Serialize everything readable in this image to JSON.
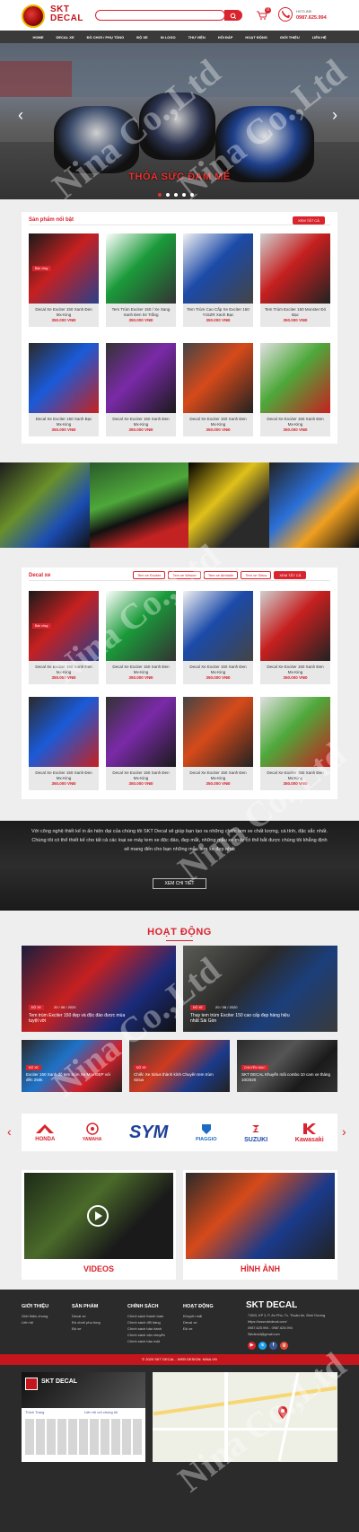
{
  "header": {
    "logo_top": "SKT",
    "logo_bottom": "DECAL",
    "cart_count": "0",
    "hotline_label": "HOTLINE",
    "hotline_number": "0987.625.994"
  },
  "nav": [
    "HOME",
    "DECAL XE",
    "ĐỒ CHƠI / PHỤ TÙNG",
    "ĐỘ XE",
    "IN LOGO",
    "THƯ VIỆN",
    "HỎI ĐÁP",
    "HOẠT ĐỘNG",
    "GIỚI THIỆU",
    "LIÊN HỆ"
  ],
  "banner": {
    "slogan": "THỎA SỨC ĐAM MÊ",
    "prev": "‹",
    "next": "›"
  },
  "featured": {
    "title": "Sản phẩm nổi bật",
    "view_all": "XEM TẤT CẢ",
    "products": [
      {
        "name": "Decal Xe Exciter 150 Xanh Đen Mx-King",
        "price": "350.000 VNĐ",
        "badge": "Bán chạy"
      },
      {
        "name": "Tem Trùm Exciter 150 / Xe Sang Xanh Đen 04 Trắng",
        "price": "350.000 VNĐ"
      },
      {
        "name": "Tem Trùm Cao Cấp Xe Exciter 150 Y15ZR Xanh Bạc",
        "price": "350.000 VNĐ"
      },
      {
        "name": "Tem Trùm Exciter 150 Monster Đỏ Bạc",
        "price": "350.000 VNĐ"
      },
      {
        "name": "Decal Xe Exciter 150 Xanh Bạc Mx-King",
        "price": "350.000 VNĐ"
      },
      {
        "name": "Decal Xe Exciter 150 Xanh Đen Mx-King",
        "price": "350.000 VNĐ"
      },
      {
        "name": "Decal Xe Exciter 150 Xanh Đen Mx-King",
        "price": "350.000 VNĐ"
      },
      {
        "name": "Decal Xe Exciter 150 Xanh Đen Mx-King",
        "price": "350.000 VNĐ"
      }
    ]
  },
  "decal": {
    "title": "Decal xe",
    "tabs": [
      "Tem xe Exciter",
      "Tem xe Winner",
      "Tem xe Airblade",
      "Tem xe Sirius"
    ],
    "view_all": "XEM TẤT CẢ",
    "products": [
      {
        "name": "Decal Xe Exciter 150 Xanh Đen Mx-King",
        "price": "350.000 VNĐ",
        "badge": "Bán chạy"
      },
      {
        "name": "Decal Xe Exciter 150 Xanh Đen Mx-King",
        "price": "350.000 VNĐ"
      },
      {
        "name": "Decal Xe Exciter 150 Xanh Đen Mx-King",
        "price": "350.000 VNĐ"
      },
      {
        "name": "Decal Xe Exciter 150 Xanh Đen Mx-King",
        "price": "350.000 VNĐ"
      },
      {
        "name": "Decal Xe Exciter 150 Xanh Đen Mx-King",
        "price": "350.000 VNĐ"
      },
      {
        "name": "Decal Xe Exciter 150 Xanh Đen Mx-King",
        "price": "350.000 VNĐ"
      },
      {
        "name": "Decal Xe Exciter 150 Xanh Đen Mx-King",
        "price": "350.000 VNĐ"
      },
      {
        "name": "Decal Xe Exciter 150 Xanh Đen Mx-King",
        "price": "350.000 VNĐ"
      }
    ]
  },
  "about": {
    "text": "Với công nghệ thiết kế in ấn hiện đại của chúng tôi SKT Decal sẽ giúp bạn tạo ra những chiếc tem xe chất lượng, cá tính, đặc sắc nhất. Chúng tôi có thể thiết kế cho tất cả các loại xe máy tem xe độc đáo, đẹp mắt, những mẫu xe máy có thể bắt được chúng tôi khẳng định sẽ mang đến cho bạn những mẫu tem xe đẹp nhất",
    "button": "XEM CHI TIẾT"
  },
  "activities": {
    "title": "HOẠT ĐỘNG",
    "items": [
      {
        "tag": "ĐỘ XE",
        "date": "20 / 08 / 2020",
        "caption": "Tem trùm Exciter 150 đẹp và độc đáo được mùa tuyệt vời"
      },
      {
        "tag": "ĐỘ XE",
        "date": "20 / 08 / 2020",
        "caption": "Thay tem trùm Exciter 150 cao cấp đẹp hàng hiệu nhất Sài Gòn"
      },
      {
        "tag": "ĐỘ XE",
        "caption": "Exciter 150 Xanh độ tem trùm Xe Max ĐẸP với đến 250k"
      },
      {
        "tag": "ĐỘ XE",
        "caption": "Chiếc Xe Sirius thành kính Chuyên tem trùm Sirius"
      },
      {
        "tag": "CHUYÊN MỤC",
        "caption": "SKT DECAL Khuyến mãi combo 10 cam xe tháng 10/2020"
      }
    ]
  },
  "brands": [
    "HONDA",
    "YAMAHA",
    "SYM",
    "PIAGGIO",
    "SUZUKI",
    "Kawasaki"
  ],
  "media": {
    "videos": "VIDEOS",
    "images": "HÌNH ẢNH"
  },
  "footer": {
    "col1_title": "GIỚI THIỆU",
    "col1_items": [
      "Giới thiệu chung",
      "Liên hệ"
    ],
    "col2_title": "SẢN PHẨM",
    "col2_items": [
      "Decal xe",
      "Đồ chơi/ phụ tùng",
      "Độ xe"
    ],
    "col3_title": "CHÍNH SÁCH",
    "col3_items": [
      "Chính sách thanh toán",
      "Chính sách đổi hàng",
      "Chính sách bảo hành",
      "Chính sách vận chuyển",
      "Chính sách bảo mật"
    ],
    "col4_title": "HOẠT ĐỘNG",
    "col4_items": [
      "Khuyến mãi",
      "Decal xe",
      "Độ xe"
    ],
    "brand": "SKT DECAL",
    "address": "71B/3, KP 2, P. An Phú, Tx. Thuận An, Bình Dương",
    "website": "https://www.sktdecal.com/",
    "phone": "0987.625.994 - 0987.625.994",
    "email": "Sktdecal@gmail.com",
    "copyright": "© 2020 SKT DECAL - WEB DESIGN: NINA.VN"
  },
  "fanpage": {
    "name": "SKT DECAL",
    "like": "Thích Trang",
    "contact": "Liên hệ với chúng tôi"
  },
  "watermark": "Nina Co.,Ltd"
}
